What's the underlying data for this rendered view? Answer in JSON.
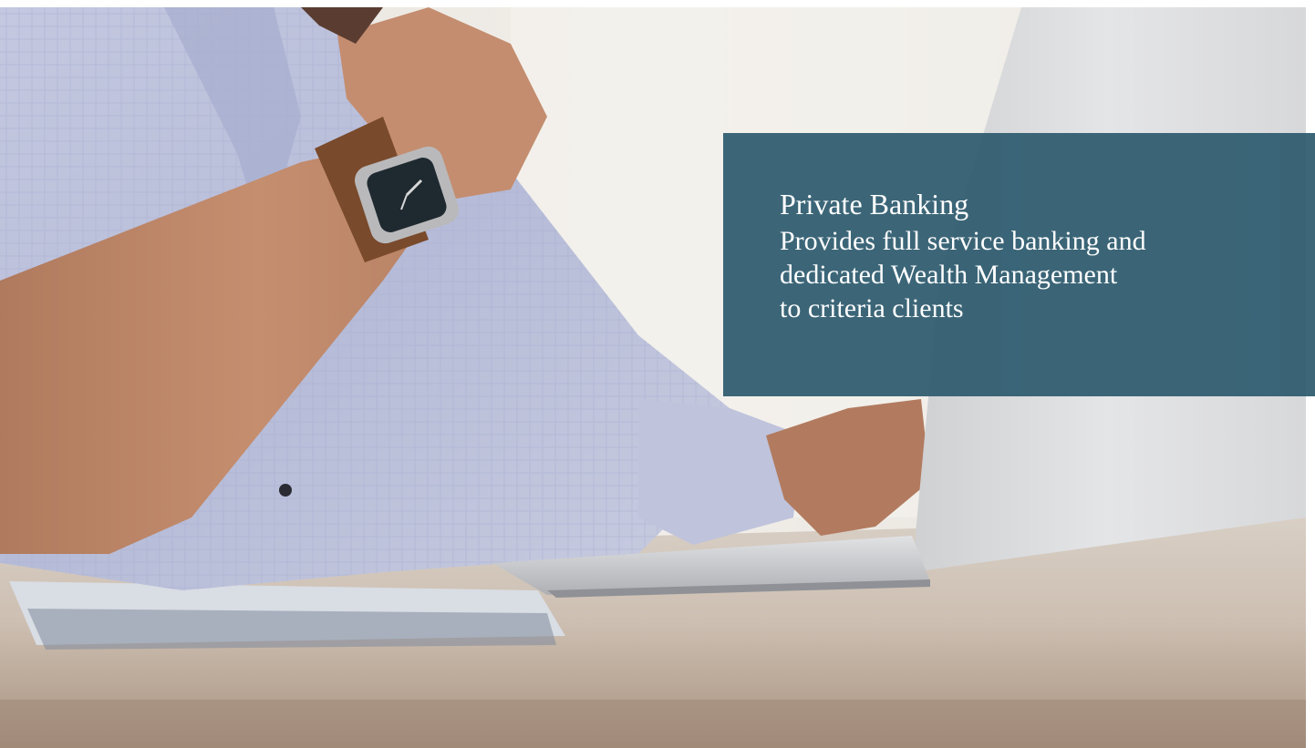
{
  "banner": {
    "title": "Private Banking",
    "description": "Provides full service banking and\ndedicated Wealth Management\nto criteria clients"
  },
  "colors": {
    "panel": "#2d5a6e",
    "panel_text": "#ffffff"
  },
  "photo": {
    "subject": "man-with-wristwatch-using-laptop"
  }
}
